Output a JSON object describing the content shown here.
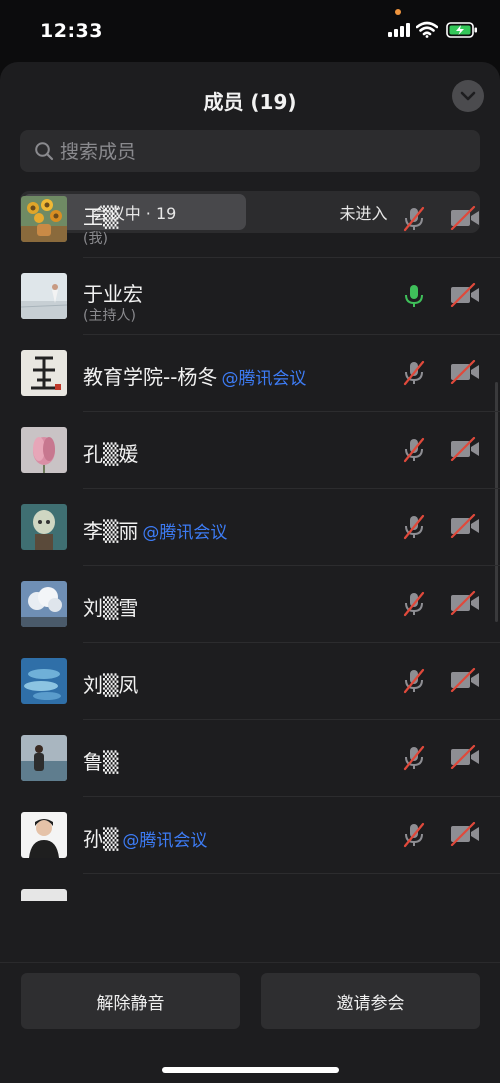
{
  "status_bar": {
    "time": "12:33"
  },
  "sheet": {
    "title": "成员 (19)"
  },
  "search": {
    "placeholder": "搜索成员"
  },
  "tabs": [
    {
      "label": "会议中 · 19",
      "active": true
    },
    {
      "label": "未进入",
      "active": false
    }
  ],
  "members": [
    {
      "name": "王▒",
      "sub": "(我)",
      "tag": "",
      "mic": "muted",
      "camera": "off",
      "avatar": "sunflower-painting"
    },
    {
      "name": "于业宏",
      "sub": "(主持人)",
      "tag": "",
      "mic": "on",
      "camera": "off",
      "avatar": "beach-figure"
    },
    {
      "name": "教育学院--杨冬",
      "sub": "",
      "tag": "@腾讯会议",
      "mic": "muted",
      "camera": "off",
      "avatar": "calligraphy"
    },
    {
      "name": "孔▒媛",
      "sub": "",
      "tag": "",
      "mic": "muted",
      "camera": "off",
      "avatar": "pink-flower"
    },
    {
      "name": "李▒丽",
      "sub": "",
      "tag": "@腾讯会议",
      "mic": "muted",
      "camera": "off",
      "avatar": "cartoon-child"
    },
    {
      "name": "刘▒雪",
      "sub": "",
      "tag": "",
      "mic": "muted",
      "camera": "off",
      "avatar": "clouds"
    },
    {
      "name": "刘▒凤",
      "sub": "",
      "tag": "",
      "mic": "muted",
      "camera": "off",
      "avatar": "fish-painting"
    },
    {
      "name": "鲁▒",
      "sub": "",
      "tag": "",
      "mic": "muted",
      "camera": "off",
      "avatar": "person-seaside"
    },
    {
      "name": "孙▒",
      "sub": "",
      "tag": "@腾讯会议",
      "mic": "muted",
      "camera": "off",
      "avatar": "portrait-photo"
    },
    {
      "name": "",
      "sub": "",
      "tag": "",
      "mic": "muted",
      "camera": "off",
      "avatar": "partial"
    }
  ],
  "footer": {
    "unmute_label": "解除静音",
    "invite_label": "邀请参会"
  },
  "colors": {
    "tag_blue": "#3d7cf5",
    "mic_on_green": "#3fbf5a",
    "muted_red": "#e0493b"
  }
}
